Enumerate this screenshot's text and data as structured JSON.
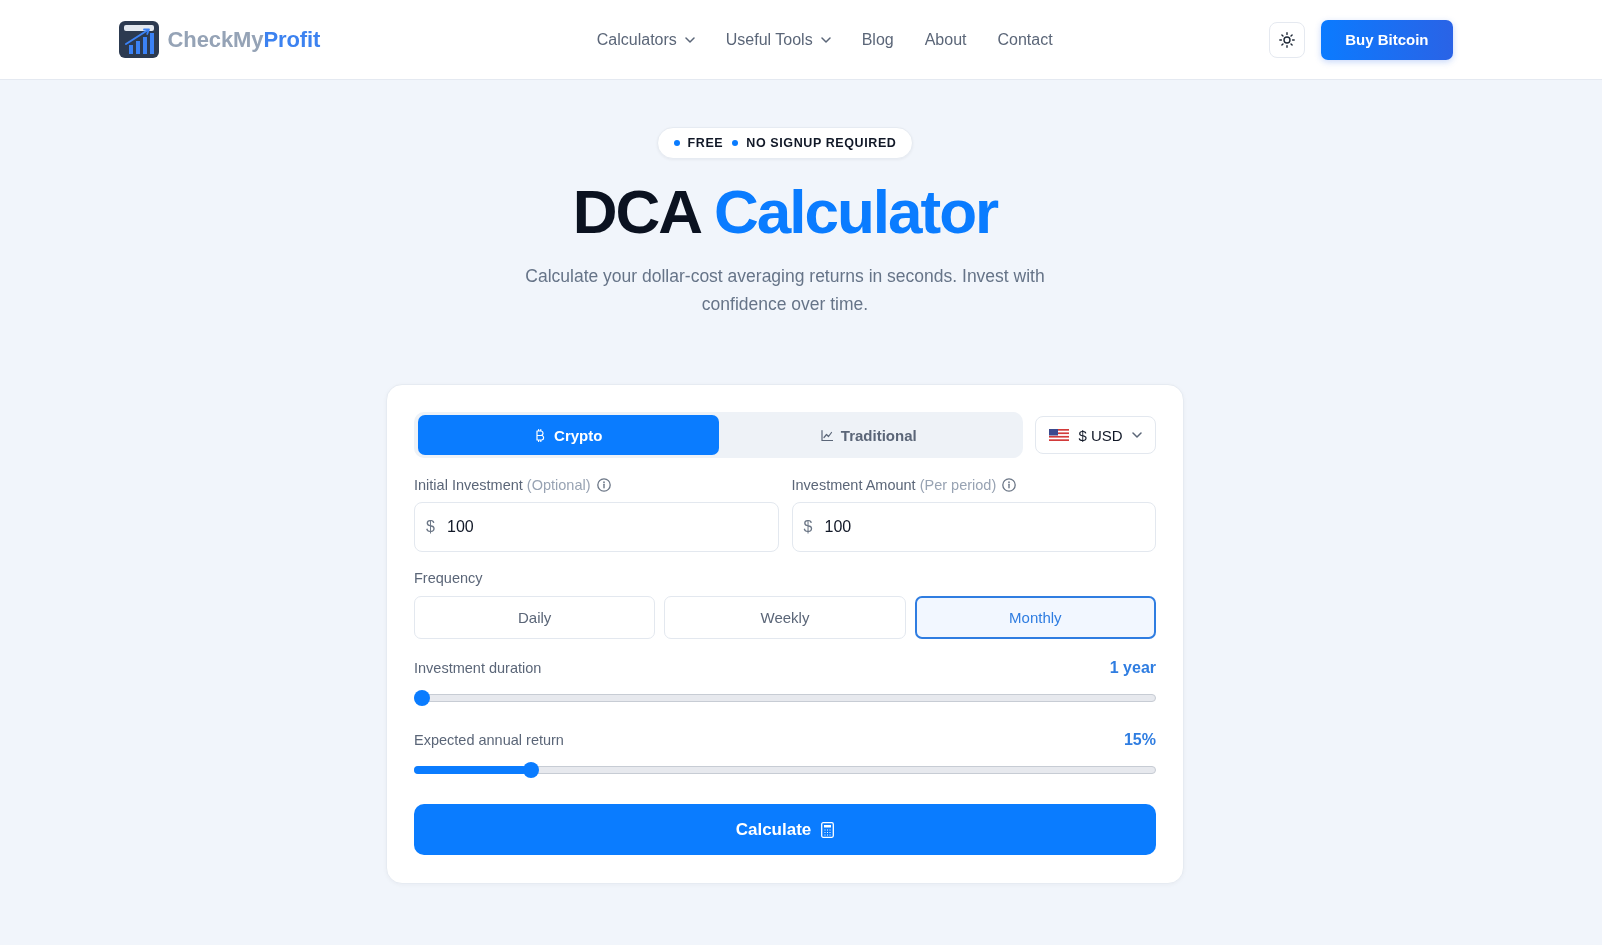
{
  "header": {
    "brand": {
      "name_start": "CheckMy",
      "name_end": "Profit"
    },
    "nav": [
      {
        "label": "Calculators",
        "dropdown": true
      },
      {
        "label": "Useful Tools",
        "dropdown": true
      },
      {
        "label": "Blog",
        "dropdown": false
      },
      {
        "label": "About",
        "dropdown": false
      },
      {
        "label": "Contact",
        "dropdown": false
      }
    ],
    "cta": "Buy Bitcoin"
  },
  "hero": {
    "badges": [
      "FREE",
      "NO SIGNUP REQUIRED"
    ],
    "title": {
      "lead": "DCA",
      "highlight": "Calculator"
    },
    "subtitle": "Calculate your dollar-cost averaging returns in seconds. Invest with confidence over time."
  },
  "calculator": {
    "asset_tabs": [
      {
        "label": "Crypto",
        "selected": true
      },
      {
        "label": "Traditional",
        "selected": false
      }
    ],
    "currency": "$ USD",
    "fields": [
      {
        "label": "Initial Investment",
        "hint": "(Optional)",
        "prefix": "$",
        "value": "100"
      },
      {
        "label": "Investment Amount",
        "hint": "(Per period)",
        "prefix": "$",
        "value": "100"
      }
    ],
    "frequency": {
      "label": "Frequency",
      "options": [
        {
          "label": "Daily",
          "selected": false
        },
        {
          "label": "Weekly",
          "selected": false
        },
        {
          "label": "Monthly",
          "selected": true
        }
      ]
    },
    "sliders": [
      {
        "label": "Investment duration",
        "reading": "1 year",
        "level": 0
      },
      {
        "label": "Expected annual return",
        "reading": "15%",
        "level": 0.15
      }
    ],
    "submit": "Calculate"
  }
}
